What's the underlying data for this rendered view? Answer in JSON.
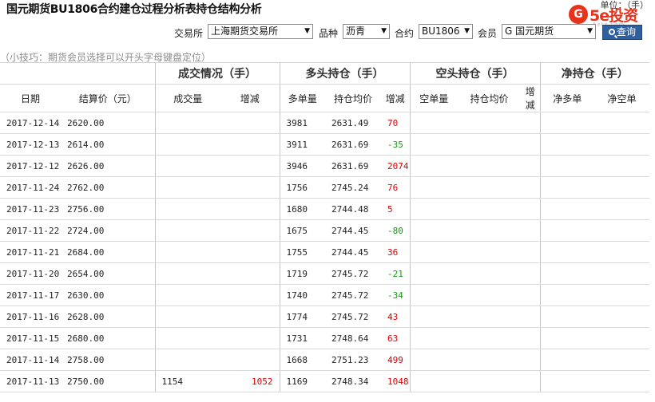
{
  "title": "国元期货BU1806合约建仓过程分析表持仓结构分析",
  "unit_label": "单位：（手）",
  "logo": {
    "circle_char": "G",
    "text": "5e投资",
    "sub": "5etz.com"
  },
  "filters": {
    "exchange_label": "交易所",
    "exchange_value": "上海期货交易所",
    "variety_label": "品种",
    "variety_value": "沥青",
    "contract_label": "合约",
    "contract_value": "BU1806",
    "member_label": "会员",
    "member_value": "G 国元期货",
    "query_label": "查询"
  },
  "tip": "（小技巧：期货会员选择可以开头字母键盘定位）",
  "groups": [
    "成交情况（手）",
    "多头持仓（手）",
    "空头持仓（手）",
    "净持仓（手）"
  ],
  "columns": [
    "日期",
    "结算价（元）",
    "成交量",
    "增减",
    "多单量",
    "持仓均价",
    "增减",
    "空单量",
    "持仓均价",
    "增减",
    "净多单",
    "净空单"
  ],
  "rows": [
    {
      "date": "2017-12-14",
      "price": "2620.00",
      "vol": "",
      "vol_chg": "",
      "long": "3981",
      "long_avg": "2631.49",
      "long_chg": "70"
    },
    {
      "date": "2017-12-13",
      "price": "2614.00",
      "vol": "",
      "vol_chg": "",
      "long": "3911",
      "long_avg": "2631.69",
      "long_chg": "-35"
    },
    {
      "date": "2017-12-12",
      "price": "2626.00",
      "vol": "",
      "vol_chg": "",
      "long": "3946",
      "long_avg": "2631.69",
      "long_chg": "2074"
    },
    {
      "date": "2017-11-24",
      "price": "2762.00",
      "vol": "",
      "vol_chg": "",
      "long": "1756",
      "long_avg": "2745.24",
      "long_chg": "76"
    },
    {
      "date": "2017-11-23",
      "price": "2756.00",
      "vol": "",
      "vol_chg": "",
      "long": "1680",
      "long_avg": "2744.48",
      "long_chg": "5"
    },
    {
      "date": "2017-11-22",
      "price": "2724.00",
      "vol": "",
      "vol_chg": "",
      "long": "1675",
      "long_avg": "2744.45",
      "long_chg": "-80"
    },
    {
      "date": "2017-11-21",
      "price": "2684.00",
      "vol": "",
      "vol_chg": "",
      "long": "1755",
      "long_avg": "2744.45",
      "long_chg": "36"
    },
    {
      "date": "2017-11-20",
      "price": "2654.00",
      "vol": "",
      "vol_chg": "",
      "long": "1719",
      "long_avg": "2745.72",
      "long_chg": "-21"
    },
    {
      "date": "2017-11-17",
      "price": "2630.00",
      "vol": "",
      "vol_chg": "",
      "long": "1740",
      "long_avg": "2745.72",
      "long_chg": "-34"
    },
    {
      "date": "2017-11-16",
      "price": "2628.00",
      "vol": "",
      "vol_chg": "",
      "long": "1774",
      "long_avg": "2745.72",
      "long_chg": "43"
    },
    {
      "date": "2017-11-15",
      "price": "2680.00",
      "vol": "",
      "vol_chg": "",
      "long": "1731",
      "long_avg": "2748.64",
      "long_chg": "63"
    },
    {
      "date": "2017-11-14",
      "price": "2758.00",
      "vol": "",
      "vol_chg": "",
      "long": "1668",
      "long_avg": "2751.23",
      "long_chg": "499"
    },
    {
      "date": "2017-11-13",
      "price": "2750.00",
      "vol": "1154",
      "vol_chg": "1052",
      "long": "1169",
      "long_avg": "2748.34",
      "long_chg": "1048"
    }
  ],
  "colors": {
    "positive": "#dd0000",
    "negative": "#119a11",
    "button": "#2e5f9e",
    "logo": "#e8331c"
  }
}
